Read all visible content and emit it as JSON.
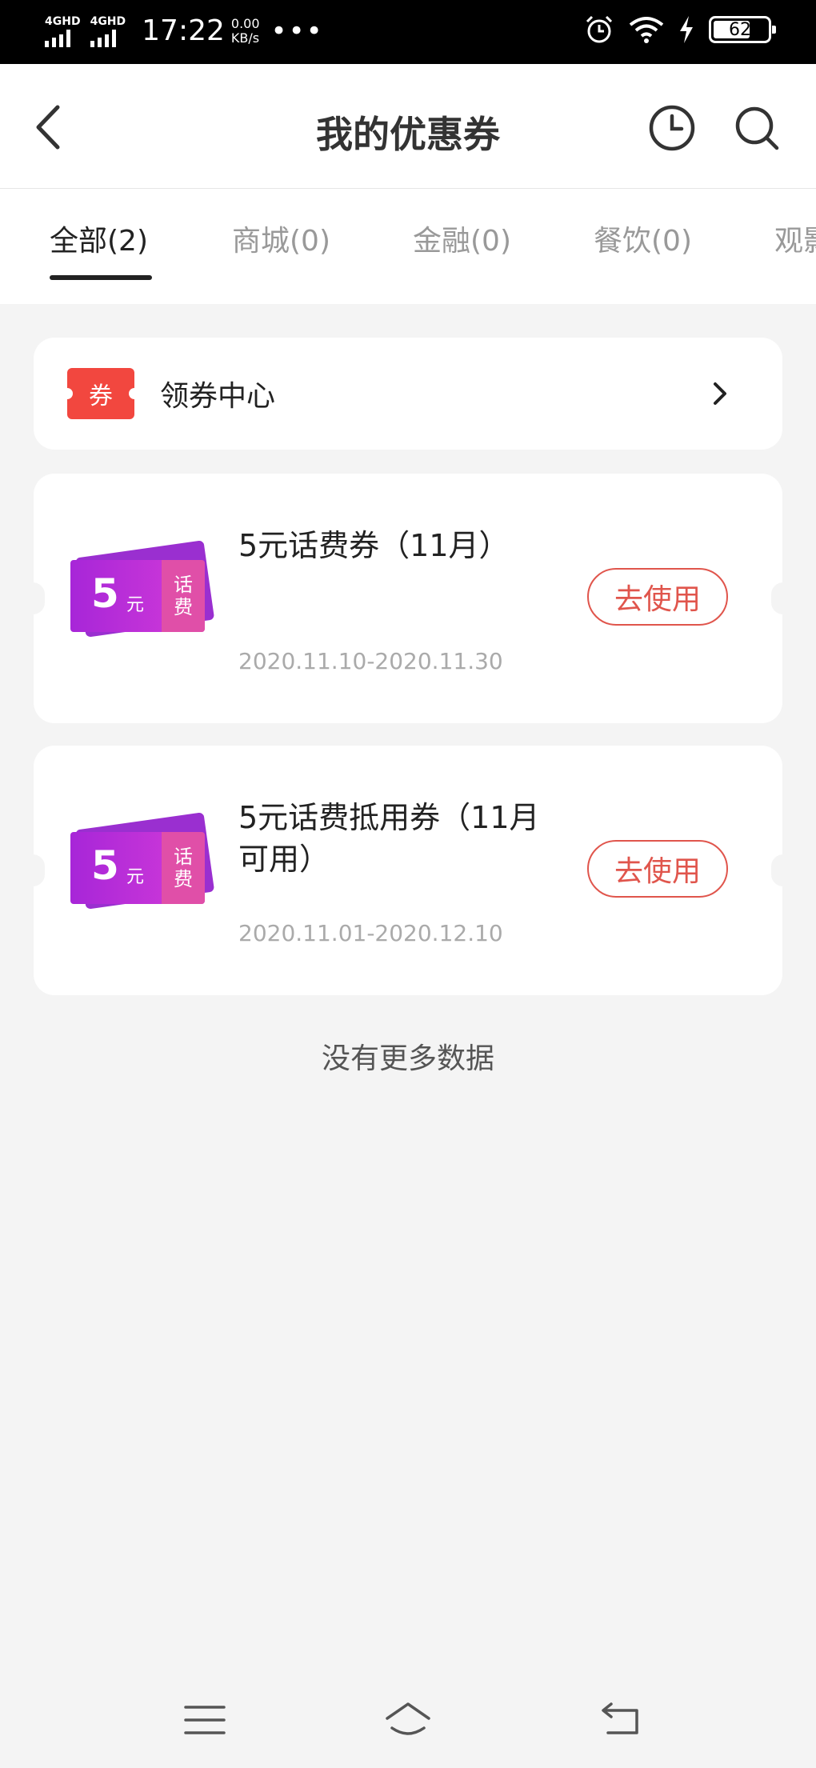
{
  "status_bar": {
    "network_1": "4GHD",
    "network_2": "4GHD",
    "time": "17:22",
    "speed_value": "0.00",
    "speed_unit": "KB/s",
    "more": "•••",
    "battery": "62"
  },
  "header": {
    "title": "我的优惠券",
    "icons": [
      "back-icon",
      "history-clock-icon",
      "search-icon"
    ]
  },
  "tabs": [
    {
      "label": "全部(2)",
      "active": true
    },
    {
      "label": "商城(0)",
      "active": false
    },
    {
      "label": "金融(0)",
      "active": false
    },
    {
      "label": "餐饮(0)",
      "active": false
    },
    {
      "label": "观影",
      "active": false
    }
  ],
  "coupon_center": {
    "tag": "券",
    "label": "领券中心"
  },
  "coupons": [
    {
      "amount": "5",
      "unit": "元",
      "type_line1": "话",
      "type_line2": "费",
      "title": "5元话费券（11月）",
      "validity": "2020.11.10-2020.11.30",
      "action": "去使用"
    },
    {
      "amount": "5",
      "unit": "元",
      "type_line1": "话",
      "type_line2": "费",
      "title": "5元话费抵用券（11月可用）",
      "validity": "2020.11.01-2020.12.10",
      "action": "去使用"
    }
  ],
  "footer": {
    "no_more": "没有更多数据"
  },
  "colors": {
    "accent_red": "#e0554c",
    "tag_red": "#f2473f",
    "ticket_purple": "#a726d8",
    "background": "#f4f4f4"
  }
}
